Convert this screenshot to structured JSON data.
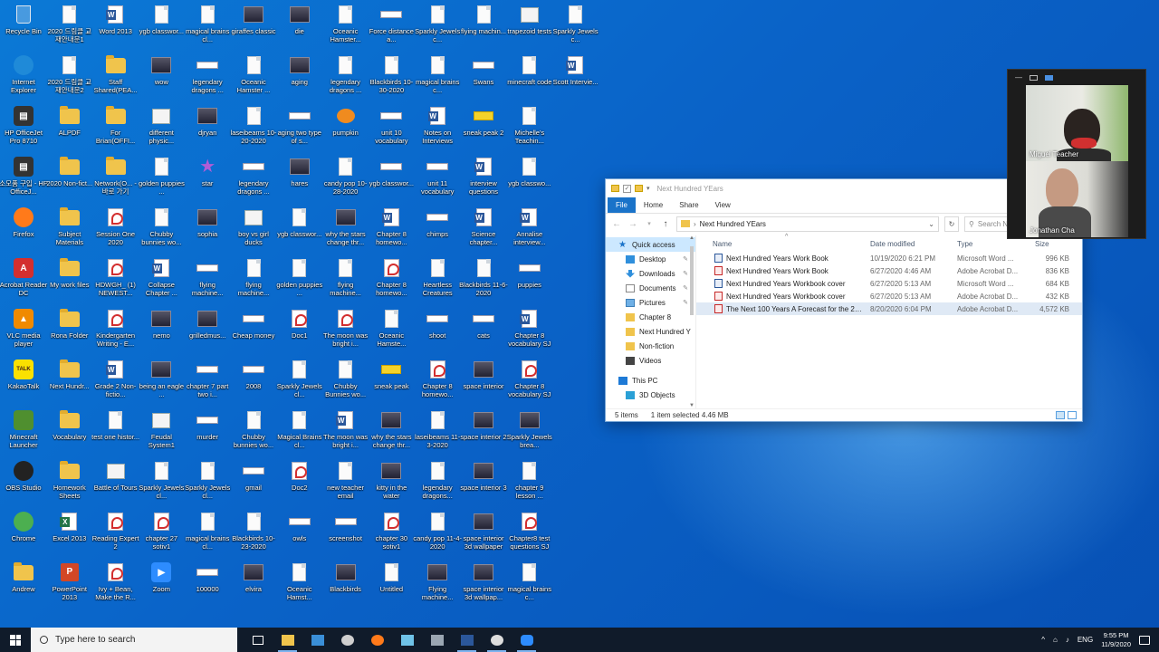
{
  "desktop": {
    "icons": [
      {
        "label": "Recycle Bin",
        "kind": "bin"
      },
      {
        "label": "2020 드림클 교재안내문1",
        "kind": "doc"
      },
      {
        "label": "Word 2013",
        "kind": "word"
      },
      {
        "label": "ygb classwor...",
        "kind": "doc"
      },
      {
        "label": "magical brains cl...",
        "kind": "doc"
      },
      {
        "label": "giraffes classic",
        "kind": "photo"
      },
      {
        "label": "die",
        "kind": "photo"
      },
      {
        "label": "Oceanic Hamster...",
        "kind": "doc"
      },
      {
        "label": "Force distance a...",
        "kind": "flat"
      },
      {
        "label": "Sparkly Jewels c...",
        "kind": "doc"
      },
      {
        "label": "flying machin...",
        "kind": "doc"
      },
      {
        "label": "trapezoid tests",
        "kind": "img"
      },
      {
        "label": "Sparkly Jewels c...",
        "kind": "doc"
      },
      {
        "label": "Internet Explorer",
        "kind": "ie"
      },
      {
        "label": "2020 드림클 교재안내문2",
        "kind": "doc"
      },
      {
        "label": "Staff Shared(PEA...",
        "kind": "folder"
      },
      {
        "label": "wow",
        "kind": "photo"
      },
      {
        "label": "legendary dragons ...",
        "kind": "flat"
      },
      {
        "label": "Oceanic Hamster ...",
        "kind": "doc"
      },
      {
        "label": "aging",
        "kind": "photo"
      },
      {
        "label": "legendary dragons ...",
        "kind": "doc"
      },
      {
        "label": "Blackbirds 10-30-2020",
        "kind": "doc"
      },
      {
        "label": "magical brains c...",
        "kind": "doc"
      },
      {
        "label": "Swans",
        "kind": "flat"
      },
      {
        "label": "minecraft code",
        "kind": "doc"
      },
      {
        "label": "Scott Intervie...",
        "kind": "word"
      },
      {
        "label": "HP OfficeJet Pro 8710",
        "kind": "printer"
      },
      {
        "label": "ALPDF",
        "kind": "folder"
      },
      {
        "label": "For Brian(OFFI...",
        "kind": "folder"
      },
      {
        "label": "different physic...",
        "kind": "img"
      },
      {
        "label": "djryan",
        "kind": "photo"
      },
      {
        "label": "laseibeams 10-20-2020",
        "kind": "doc"
      },
      {
        "label": "aging two type of s...",
        "kind": "flat"
      },
      {
        "label": "pumpkin",
        "kind": "pumpkin"
      },
      {
        "label": "unit 10 vocabulary",
        "kind": "flat"
      },
      {
        "label": "Notes on Interviews",
        "kind": "word"
      },
      {
        "label": "sneak peak 2",
        "kind": "yellow"
      },
      {
        "label": "Michelle's Teachin...",
        "kind": "doc"
      },
      {
        "label": "소모품 구입 - HP OfficeJ...",
        "kind": "printer"
      },
      {
        "label": "2020 Non-fict...",
        "kind": "folder"
      },
      {
        "label": "Network(O... - 바로 가기",
        "kind": "folder"
      },
      {
        "label": "golden puppies ...",
        "kind": "doc"
      },
      {
        "label": "star",
        "kind": "star"
      },
      {
        "label": "legendary dragons ...",
        "kind": "flat"
      },
      {
        "label": "hares",
        "kind": "photo"
      },
      {
        "label": "candy pop 10-28-2020",
        "kind": "doc"
      },
      {
        "label": "ygb classwor...",
        "kind": "flat"
      },
      {
        "label": "unit 11 vocabulary",
        "kind": "flat"
      },
      {
        "label": "interview questions",
        "kind": "word"
      },
      {
        "label": "ygb classwo...",
        "kind": "doc"
      },
      {
        "label": "Firefox",
        "kind": "firefox"
      },
      {
        "label": "Subject Materials",
        "kind": "folder"
      },
      {
        "label": "Session One 2020",
        "kind": "pdf"
      },
      {
        "label": "Chubby bunnies wo...",
        "kind": "doc"
      },
      {
        "label": "sophia",
        "kind": "photo"
      },
      {
        "label": "boy vs girl ducks",
        "kind": "img"
      },
      {
        "label": "ygb classwor...",
        "kind": "doc"
      },
      {
        "label": "why the stars change thr...",
        "kind": "photo"
      },
      {
        "label": "Chapter 8 homewo...",
        "kind": "word"
      },
      {
        "label": "chimps",
        "kind": "flat"
      },
      {
        "label": "Science chapter...",
        "kind": "word"
      },
      {
        "label": "Annalise interview...",
        "kind": "word"
      },
      {
        "label": "Acrobat Reader DC",
        "kind": "acrobat"
      },
      {
        "label": "My work files",
        "kind": "folder"
      },
      {
        "label": "HDWGH_ (1) NEWEST...",
        "kind": "pdf"
      },
      {
        "label": "Collapse Chapter ...",
        "kind": "word"
      },
      {
        "label": "flying machine...",
        "kind": "flat"
      },
      {
        "label": "flying machine...",
        "kind": "doc"
      },
      {
        "label": "golden puppies ...",
        "kind": "doc"
      },
      {
        "label": "flying machine...",
        "kind": "doc"
      },
      {
        "label": "Chapter 8 homewo...",
        "kind": "pdf"
      },
      {
        "label": "Heartless Creatures",
        "kind": "doc"
      },
      {
        "label": "Blackbirds 11-6-2020",
        "kind": "doc"
      },
      {
        "label": "puppies",
        "kind": "flat"
      },
      {
        "label": "VLC media player",
        "kind": "vlc"
      },
      {
        "label": "Rona Folder",
        "kind": "folder"
      },
      {
        "label": "Kindergarten Writing - E...",
        "kind": "pdf"
      },
      {
        "label": "nemo",
        "kind": "photo"
      },
      {
        "label": "grilledmus...",
        "kind": "photo"
      },
      {
        "label": "Cheap money",
        "kind": "flat"
      },
      {
        "label": "Doc1",
        "kind": "pdf"
      },
      {
        "label": "The moon was bright i...",
        "kind": "pdf"
      },
      {
        "label": "Oceanic Hamste...",
        "kind": "doc"
      },
      {
        "label": "shoot",
        "kind": "flat"
      },
      {
        "label": "cats",
        "kind": "flat"
      },
      {
        "label": "Chapter 8 vocabulary SJ",
        "kind": "word"
      },
      {
        "label": "KakaoTalk",
        "kind": "kakao"
      },
      {
        "label": "Next Hundr...",
        "kind": "folder"
      },
      {
        "label": "Grade 2 Non-fictio...",
        "kind": "word"
      },
      {
        "label": "being an eagle ...",
        "kind": "photo"
      },
      {
        "label": "chapter 7 part two i...",
        "kind": "flat"
      },
      {
        "label": "2008",
        "kind": "flat"
      },
      {
        "label": "Sparkly Jewels cl...",
        "kind": "doc"
      },
      {
        "label": "Chubby Bunnies wo...",
        "kind": "doc"
      },
      {
        "label": "sneak peak",
        "kind": "yellow"
      },
      {
        "label": "Chapter 8 homewo...",
        "kind": "pdf"
      },
      {
        "label": "space interior",
        "kind": "photo"
      },
      {
        "label": "Chapter 8 vocabulary SJ",
        "kind": "pdf"
      },
      {
        "label": "Minecraft Launcher",
        "kind": "minecraft"
      },
      {
        "label": "Vocabulary",
        "kind": "folder"
      },
      {
        "label": "test one histor...",
        "kind": "doc"
      },
      {
        "label": "Feudal System1",
        "kind": "img"
      },
      {
        "label": "murder",
        "kind": "flat"
      },
      {
        "label": "Chubby bunnies wo...",
        "kind": "doc"
      },
      {
        "label": "Magical Brains cl...",
        "kind": "doc"
      },
      {
        "label": "The moon was bright i...",
        "kind": "word"
      },
      {
        "label": "why the stars change thr...",
        "kind": "photo"
      },
      {
        "label": "laseibeams 11-3-2020",
        "kind": "doc"
      },
      {
        "label": "space interior 2",
        "kind": "photo"
      },
      {
        "label": "Sparkly Jewels brea...",
        "kind": "photo"
      },
      {
        "label": "OBS Studio",
        "kind": "obs"
      },
      {
        "label": "Homework Sheets",
        "kind": "folder"
      },
      {
        "label": "Battle of Tours",
        "kind": "img"
      },
      {
        "label": "Sparkly Jewels cl...",
        "kind": "doc"
      },
      {
        "label": "Sparkly Jewels cl...",
        "kind": "doc"
      },
      {
        "label": "gmail",
        "kind": "flat"
      },
      {
        "label": "Doc2",
        "kind": "pdf"
      },
      {
        "label": "new teacher email",
        "kind": "doc"
      },
      {
        "label": "kitty in the water",
        "kind": "photo"
      },
      {
        "label": "legendary dragons...",
        "kind": "doc"
      },
      {
        "label": "space interior 3",
        "kind": "photo"
      },
      {
        "label": "chapter 9 lesson ...",
        "kind": "doc"
      },
      {
        "label": "Chrome",
        "kind": "chrome"
      },
      {
        "label": "Excel 2013",
        "kind": "excel"
      },
      {
        "label": "Reading Expert 2",
        "kind": "pdf"
      },
      {
        "label": "chapter 27 sotiv1",
        "kind": "pdf"
      },
      {
        "label": "magical brains cl...",
        "kind": "doc"
      },
      {
        "label": "Blackbirds 10-23-2020",
        "kind": "doc"
      },
      {
        "label": "owls",
        "kind": "flat"
      },
      {
        "label": "screenshot",
        "kind": "flat"
      },
      {
        "label": "chapter 30 sotiv1",
        "kind": "pdf"
      },
      {
        "label": "candy pop 11-4-2020",
        "kind": "doc"
      },
      {
        "label": "space interior 3d wallpaper",
        "kind": "photo"
      },
      {
        "label": "Chapter8 test questions SJ",
        "kind": "pdf"
      },
      {
        "label": "Andrew",
        "kind": "folder"
      },
      {
        "label": "PowerPoint 2013",
        "kind": "ppt"
      },
      {
        "label": "Ivy + Bean, Make the R...",
        "kind": "pdf"
      },
      {
        "label": "Zoom",
        "kind": "zoom"
      },
      {
        "label": "100000",
        "kind": "flat"
      },
      {
        "label": "elvira",
        "kind": "photo"
      },
      {
        "label": "Oceanic Hamst...",
        "kind": "doc"
      },
      {
        "label": "Blackbirds",
        "kind": "photo"
      },
      {
        "label": "Untitled",
        "kind": "doc"
      },
      {
        "label": "Flying machine...",
        "kind": "photo"
      },
      {
        "label": "space interior 3d wallpap...",
        "kind": "photo"
      },
      {
        "label": "magical brains c...",
        "kind": "doc"
      }
    ]
  },
  "explorer": {
    "title": "Next Hundred YEars",
    "ribbon_tabs": [
      "File",
      "Home",
      "Share",
      "View"
    ],
    "address": "Next Hundred YEars",
    "search_placeholder": "Search N",
    "columns": {
      "name": "Name",
      "date": "Date modified",
      "type": "Type",
      "size": "Size"
    },
    "nav": [
      {
        "label": "Quick access",
        "icon": "star-icon",
        "top": true
      },
      {
        "label": "Desktop",
        "icon": "desktop-icon",
        "pinned": true
      },
      {
        "label": "Downloads",
        "icon": "downloads-icon",
        "pinned": true
      },
      {
        "label": "Documents",
        "icon": "documents-icon",
        "pinned": true
      },
      {
        "label": "Pictures",
        "icon": "pictures-icon",
        "pinned": true
      },
      {
        "label": "Chapter 8",
        "icon": "folder-icon"
      },
      {
        "label": "Next Hundred Y",
        "icon": "folder-icon"
      },
      {
        "label": "Non-fiction",
        "icon": "folder-icon"
      },
      {
        "label": "Videos",
        "icon": "videos-icon"
      },
      {
        "label": "",
        "icon": "",
        "spacer": true
      },
      {
        "label": "This PC",
        "icon": "pc-icon",
        "top": true
      },
      {
        "label": "3D Objects",
        "icon": "3d-objects-icon"
      }
    ],
    "files": [
      {
        "name": "Next Hundred Years Work Book",
        "date": "10/19/2020 6:21 PM",
        "type": "Microsoft Word ...",
        "size": "996 KB",
        "icon": "word"
      },
      {
        "name": "Next Hundred Years Work Book",
        "date": "6/27/2020 4:46 AM",
        "type": "Adobe Acrobat D...",
        "size": "836 KB",
        "icon": "pdf"
      },
      {
        "name": "Next Hundred Years Workbook cover",
        "date": "6/27/2020 5:13 AM",
        "type": "Microsoft Word ...",
        "size": "684 KB",
        "icon": "word"
      },
      {
        "name": "Next Hundred Years Workbook cover",
        "date": "6/27/2020 5:13 AM",
        "type": "Adobe Acrobat D...",
        "size": "432 KB",
        "icon": "pdf"
      },
      {
        "name": "The Next 100 Years A Forecast for the 21s...",
        "date": "8/20/2020 6:04 PM",
        "type": "Adobe Acrobat D...",
        "size": "4,572 KB",
        "icon": "pdf",
        "selected": true
      }
    ],
    "status": {
      "count": "5 items",
      "selection": "1 item selected  4.46 MB"
    }
  },
  "zoom": {
    "participants": [
      "Miguel Teacher",
      "Jonathan Cha"
    ]
  },
  "taskbar": {
    "search_placeholder": "Type here to search",
    "language": "ENG",
    "time": "9:55 PM",
    "date": "11/9/2020",
    "apps": [
      "task-view",
      "file-explorer",
      "media-app",
      "browser-app",
      "firefox",
      "notes-app",
      "calculator",
      "word",
      "obs",
      "zoom"
    ]
  }
}
